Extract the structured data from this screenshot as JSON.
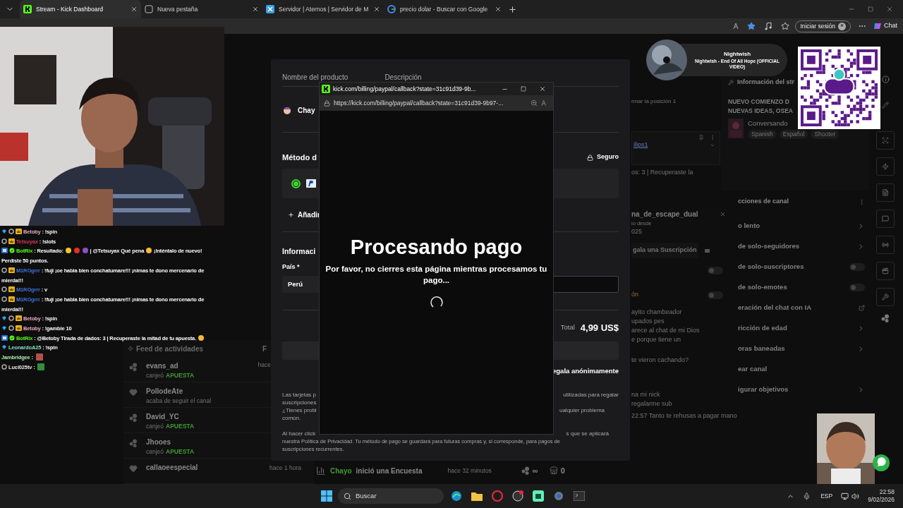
{
  "browser": {
    "tabs": [
      {
        "label": "Stream - Kick Dashboard",
        "selected": true
      },
      {
        "label": "Nueva pestaña",
        "selected": false
      },
      {
        "label": "Servidor | Aternos | Servidor de M",
        "selected": false
      },
      {
        "label": "precio dolar - Buscar con Google",
        "selected": false
      }
    ],
    "sign_in": "Iniciar sesión",
    "chat": "Chat"
  },
  "chat_overlay": [
    {
      "user": "Betoby",
      "color": "#e8a9c8",
      "parts": [
        {
          "kind": "text",
          "text": ": !spin"
        }
      ]
    },
    {
      "user": "Tetsuyax",
      "color": "#d8344f",
      "parts": [
        {
          "kind": "text",
          "text": ": !slots"
        }
      ]
    },
    {
      "user": "BotRix",
      "color": "#53fc18",
      "parts": [
        {
          "kind": "text",
          "text": ": Resultado:"
        },
        {
          "kind": "emoji",
          "color": "#f2c230"
        },
        {
          "kind": "emoji",
          "color": "#e0302a"
        },
        {
          "kind": "emoji",
          "color": "#8c4fc4"
        },
        {
          "kind": "text",
          "text": "| @Tetsuyax Qué pena"
        },
        {
          "kind": "emoji",
          "color": "#f5b83a"
        },
        {
          "kind": "text",
          "text": "¡Inténtalo de nuevo!"
        },
        {
          "kind": "text",
          "text": "Perdiste 50 puntos."
        }
      ]
    },
    {
      "user": "M1ROgrrr",
      "color": "#3f72dc",
      "parts": [
        {
          "kind": "text",
          "text": ": !fuji ¡oe habla bien conchatumare!!! ¡nimas te dono mercenario de"
        },
        {
          "kind": "text",
          "text": "mierda!!!"
        }
      ]
    },
    {
      "user": "M1ROgrrr",
      "color": "#3f72dc",
      "parts": [
        {
          "kind": "text",
          "text": ": v"
        }
      ]
    },
    {
      "user": "M1ROgrrr",
      "color": "#3f72dc",
      "parts": [
        {
          "kind": "text",
          "text": ": !fuji ¡oe habla bien conchatumare!!! ¡nimas te dono mercenario de"
        },
        {
          "kind": "text",
          "text": "mierda!!!"
        }
      ]
    },
    {
      "user": "Betoby",
      "color": "#e8a9c8",
      "parts": [
        {
          "kind": "text",
          "text": ": !spin"
        }
      ]
    },
    {
      "user": "Betoby",
      "color": "#e8a9c8",
      "parts": [
        {
          "kind": "text",
          "text": ": !gamble 10"
        }
      ]
    },
    {
      "user": "BotRix",
      "color": "#53fc18",
      "parts": [
        {
          "kind": "text",
          "text": ": @Betoby Tirada de dados: 3 | Recuperaste la mitad de tu apuesta."
        },
        {
          "kind": "emoji",
          "color": "#f5b83a"
        }
      ]
    },
    {
      "user": "LeonardoA25",
      "color": "#7ee3c0",
      "parts": [
        {
          "kind": "text",
          "text": ": !spin"
        }
      ]
    },
    {
      "user": "Jambridgee",
      "color": "#a8f0a8",
      "parts": [
        {
          "kind": "text",
          "text": ":"
        },
        {
          "kind": "emote",
          "color": "#b0524a"
        }
      ]
    },
    {
      "user": "Luci025tv",
      "color": "#e6e6e6",
      "parts": [
        {
          "kind": "text",
          "text": ":"
        },
        {
          "kind": "emote",
          "color": "#2f8f3a"
        }
      ]
    }
  ],
  "music": {
    "artist": "Nightwish",
    "track": "Nightwish - End Of All Hope (OFFICIAL VIDEO)"
  },
  "stream_info": {
    "title": "Información del str",
    "headline": [
      "NUEVO COMIENZO D",
      "NUEVAS IDEAS, OSEA"
    ],
    "category": "Conversando",
    "tags": [
      "Spanish",
      "Español",
      "Shooter"
    ]
  },
  "side_chat": {
    "pinned_hint": "rmar la posición 1",
    "pinned_link": "ilips1",
    "pinned_text": "os: 3 | Recuperaste la",
    "user_card": {
      "name": "na_de_escape_dual",
      "since": "io desde",
      "year": "025"
    },
    "gift_button": "gala una Suscripción",
    "settings": [
      {
        "on": false
      },
      {
        "label": "ón",
        "on": false
      }
    ],
    "messages": [
      "ayito chambeador",
      "upados pes",
      "arece al chat de mi Dios",
      "e porque tiene un",
      "te vieron cachando?",
      "na mi nick",
      "regalarme sub",
      "22:57 Tanto te rehusas a pagar mano"
    ]
  },
  "channel_actions": {
    "title": "cciones de canal",
    "items": [
      {
        "label": "o lento",
        "kind": "link"
      },
      {
        "label": "de solo-seguidores",
        "kind": "link"
      },
      {
        "label": "de solo-suscriptores",
        "kind": "toggle",
        "on": false
      },
      {
        "label": "de solo-emotes",
        "kind": "toggle",
        "on": false
      },
      {
        "label": "eración del chat con IA",
        "kind": "external"
      },
      {
        "label": "ricción de edad",
        "kind": "link"
      },
      {
        "label": "oras baneadas",
        "kind": "link"
      },
      {
        "label": "ear canal",
        "kind": "plain"
      },
      {
        "label": "igurar objetivos",
        "kind": "link"
      }
    ]
  },
  "checkout": {
    "product_header": "Nombre del producto",
    "description_header": "Descripción",
    "product": "Chay",
    "payment_title": "Método d",
    "secure": "Seguro",
    "paypal_selected": true,
    "add": "Añadir",
    "info_title": "Informaci",
    "country_label": "País *",
    "country": "Perú",
    "total_label": "Total",
    "total": "4,99 US$",
    "gift_anonymous": "egala anónimamente",
    "notes": [
      {
        "left": "Las tarjetas p",
        "right": "utilizadas para regalar"
      },
      {
        "left": "suscripciones"
      },
      {
        "left": "¿Tienes probl",
        "right": "ualquier problema"
      },
      {
        "left": "común."
      }
    ],
    "legal_first": {
      "left": "Al hacer click",
      "right": "s que se aplicará"
    },
    "legal_rest": [
      "nuestra Política de Privacidad. Tu método de pago se guardará para futuras compras y, si corresponde, para pagos de",
      "suscripciones recurrentes."
    ]
  },
  "popup": {
    "title": "kick.com/billing/paypal/callback?state=31c91d39-9b...",
    "url": "https://kick.com/billing/paypal/callback?state=31c91d39-9b97-...",
    "heading": "Procesando pago",
    "message": "Por favor, no cierres esta página mientras procesamos tu pago..."
  },
  "activity_feed": {
    "title": "Feed de actividades",
    "column_2": "F",
    "items": [
      {
        "kind": "redeem",
        "user": "evans_ad",
        "action": "canjeó",
        "reward": "APUESTA",
        "time": "hace"
      },
      {
        "kind": "follow",
        "user": "PollodeAte",
        "action": "acaba de seguir el canal"
      },
      {
        "kind": "redeem",
        "user": "David_YC",
        "action": "canjeó",
        "reward": "APUESTA"
      },
      {
        "kind": "redeem",
        "user": "Jhooes",
        "action": "canjeó",
        "reward": "APUESTA"
      },
      {
        "kind": "follow",
        "user": "callaoeespecial",
        "time": "hace 1 hora"
      }
    ],
    "poll": {
      "user": "Chayo",
      "action": "inició una Encuesta",
      "time": "hace 32 minutos"
    },
    "stats": [
      {
        "kind": "points",
        "value": "∞"
      },
      {
        "kind": "store",
        "value": "0"
      }
    ]
  },
  "taskbar": {
    "search": "Buscar",
    "language": "ESP",
    "time": "22:58",
    "date": "9/02/2026"
  }
}
